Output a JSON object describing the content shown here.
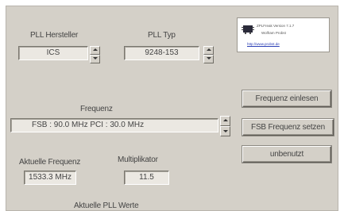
{
  "pll": {
    "hersteller_label": "PLL Hersteller",
    "hersteller_value": "ICS",
    "typ_label": "PLL Typ",
    "typ_value": "9248-153"
  },
  "info": {
    "version": "ZPLFreak Version 7.1.7",
    "author": "Wolfram Probst",
    "link": "http://www.probst.de"
  },
  "buttons": {
    "read": "Frequenz einlesen",
    "set": "FSB Frequenz setzen",
    "unused": "unbenutzt"
  },
  "freq": {
    "label": "Frequenz",
    "value": "FSB : 90.0 MHz  PCI : 30.0 MHz"
  },
  "current": {
    "label": "Aktuelle Frequenz",
    "value": "1533.3 MHz"
  },
  "multiplier": {
    "label": "Multiplikator",
    "value": "11.5"
  },
  "pll_values_label": "Aktuelle PLL Werte"
}
